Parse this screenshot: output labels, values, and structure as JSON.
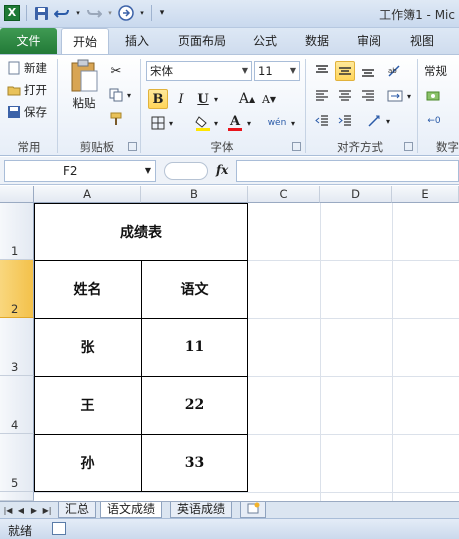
{
  "window": {
    "title": "工作簿1 - Mic"
  },
  "ribbon_tabs": [
    {
      "label": "文件"
    },
    {
      "label": "开始"
    },
    {
      "label": "插入"
    },
    {
      "label": "页面布局"
    },
    {
      "label": "公式"
    },
    {
      "label": "数据"
    },
    {
      "label": "审阅"
    },
    {
      "label": "视图"
    }
  ],
  "active_tab": "开始",
  "ribbon": {
    "common": {
      "new": "新建",
      "open": "打开",
      "save": "保存",
      "group": "常用"
    },
    "clipboard": {
      "paste": "粘贴",
      "group": "剪贴板"
    },
    "font": {
      "name": "宋体",
      "size": "11",
      "bold": "B",
      "italic": "I",
      "underline": "U",
      "grow": "A",
      "shrink": "A",
      "font_color": "A",
      "phonetic": "wén",
      "group": "字体"
    },
    "alignment": {
      "group": "对齐方式"
    },
    "number": {
      "format": "常规",
      "group": "数字"
    }
  },
  "formula_bar": {
    "name_box": "F2",
    "fx": "fx",
    "formula": ""
  },
  "columns": [
    "A",
    "B",
    "C",
    "D",
    "E"
  ],
  "rows": [
    "1",
    "2",
    "3",
    "4",
    "5"
  ],
  "selected_row": "2",
  "sheet": {
    "title": "成绩表",
    "headers": [
      "姓名",
      "语文"
    ],
    "records": [
      [
        "张",
        "11"
      ],
      [
        "王",
        "22"
      ],
      [
        "孙",
        "33"
      ]
    ]
  },
  "sheet_tabs": [
    {
      "label": "汇总"
    },
    {
      "label": "语文成绩"
    },
    {
      "label": "英语成绩"
    }
  ],
  "active_sheet": "语文成绩",
  "status": {
    "text": "就绪"
  },
  "colors": {
    "file_tab": "#2d8a43",
    "selected_row_header": "#f3c14a",
    "bold_highlight": "#ffd55a"
  }
}
